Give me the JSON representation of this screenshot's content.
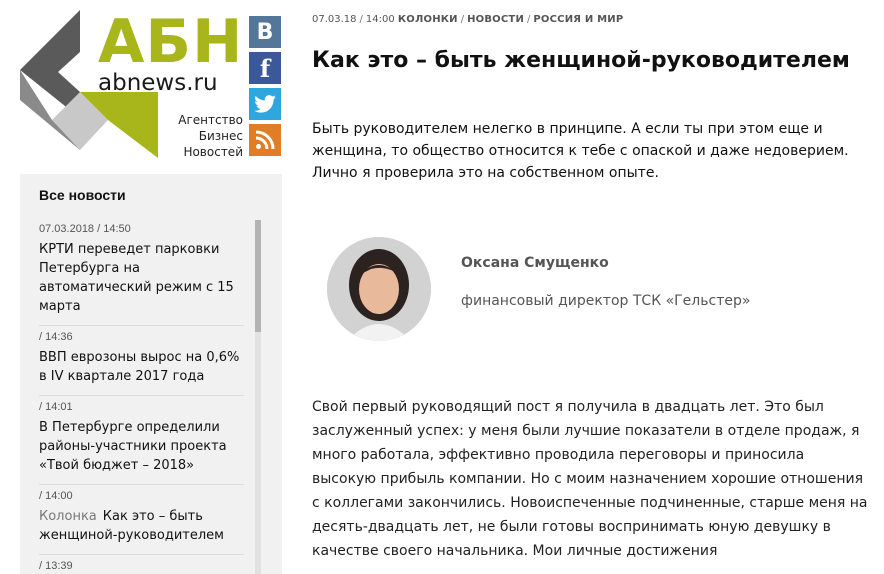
{
  "logo": {
    "abbr": "АБН",
    "domain": "abnews.ru",
    "tagline": [
      "Агентство",
      "Бизнес",
      "Новостей"
    ]
  },
  "social": [
    {
      "name": "vk",
      "label": "В",
      "color": "#54769a"
    },
    {
      "name": "facebook",
      "label": "f",
      "color": "#3b5998"
    },
    {
      "name": "twitter",
      "icon": "twitter-bird-icon",
      "color": "#2fa6dd"
    },
    {
      "name": "rss",
      "icon": "rss-icon",
      "color": "#e07d27"
    }
  ],
  "sidebar": {
    "title": "Все новости",
    "items": [
      {
        "time": "07.03.2018 / 14:50",
        "text": "КРТИ переведет парковки Петербурга на автоматический режим с 15 марта"
      },
      {
        "time": "/ 14:36",
        "text": "ВВП еврозоны вырос на 0,6% в IV квартале 2017 года"
      },
      {
        "time": "/ 14:01",
        "text": "В Петербурге определили районы-участники проекта «Твой бюджет – 2018»"
      },
      {
        "time": "/ 14:00",
        "tag": "Колонка",
        "text": "Как это – быть женщиной-руководителем"
      },
      {
        "time": "/ 13:39",
        "text": ""
      }
    ]
  },
  "article": {
    "meta": {
      "date": "07.03.18",
      "time": "14:00",
      "categories": [
        "КОЛОНКИ",
        "НОВОСТИ",
        "РОССИЯ И МИР"
      ]
    },
    "title": "Как это – быть женщиной-руководителем",
    "lead": "Быть руководителем нелегко в принципе. А если ты при этом еще и женщина, то общество относится к тебе с опаской и даже недоверием. Лично я проверила это на собственном опыте.",
    "author": {
      "name": "Оксана Смущенко",
      "role": "финансовый директор ТСК «Гельстер»"
    },
    "body": "Свой первый руководящий пост я получила в двадцать лет. Это был заслуженный успех: у меня были лучшие показатели в отделе продаж, я много работала, эффективно проводила переговоры и приносила высокую прибыль компании. Но с моим назначением хорошие отношения с коллегами закончились. Новоиспеченные подчиненные, старше меня на десять-двадцать лет, не были готовы воспринимать юную девушку в качестве своего начальника. Мои личные достижения"
  },
  "colors": {
    "brand_green": "#a8b51b",
    "logo_gray": "#5a5a5a",
    "sidebar_bg": "#f1f1f1"
  }
}
